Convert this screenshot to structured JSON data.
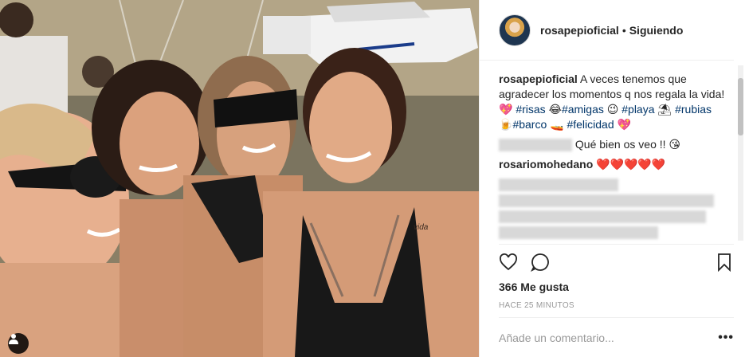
{
  "post": {
    "image_alt": "Foto de cuatro amigas sonriendo en un barco",
    "tattoo_text": "vida"
  },
  "header": {
    "username": "rosapepioficial",
    "separator": "•",
    "follow_status": "Siguiendo"
  },
  "caption": {
    "username": "rosapepioficial",
    "text_1": "A veces tenemos que agradecer los momentos q nos regala la vida!",
    "emoji_heart": "💖",
    "tag_risas": "#risas",
    "emoji_laugh": "😂",
    "tag_amigas": "#amigas",
    "emoji_wink": "😉",
    "tag_playa": "#playa",
    "emoji_float": "⛱",
    "tag_rubias": "#rubias",
    "emoji_beer": "🍺",
    "tag_barco": "#barco",
    "emoji_boat": "🚤",
    "tag_felicidad": "#felicidad",
    "emoji_heart2": "💖"
  },
  "comments": [
    {
      "text": "Qué bien os veo !!",
      "emoji": "😘"
    },
    {
      "username": "rosariomohedano",
      "hearts": "❤️❤️❤️❤️❤️"
    }
  ],
  "actions": {
    "like_icon": "heart-icon",
    "comment_icon": "comment-icon",
    "save_icon": "bookmark-icon"
  },
  "likes": "366 Me gusta",
  "timestamp": "HACE 25 MINUTOS",
  "add_comment": {
    "placeholder": "Añade un comentario...",
    "more": "•••"
  }
}
